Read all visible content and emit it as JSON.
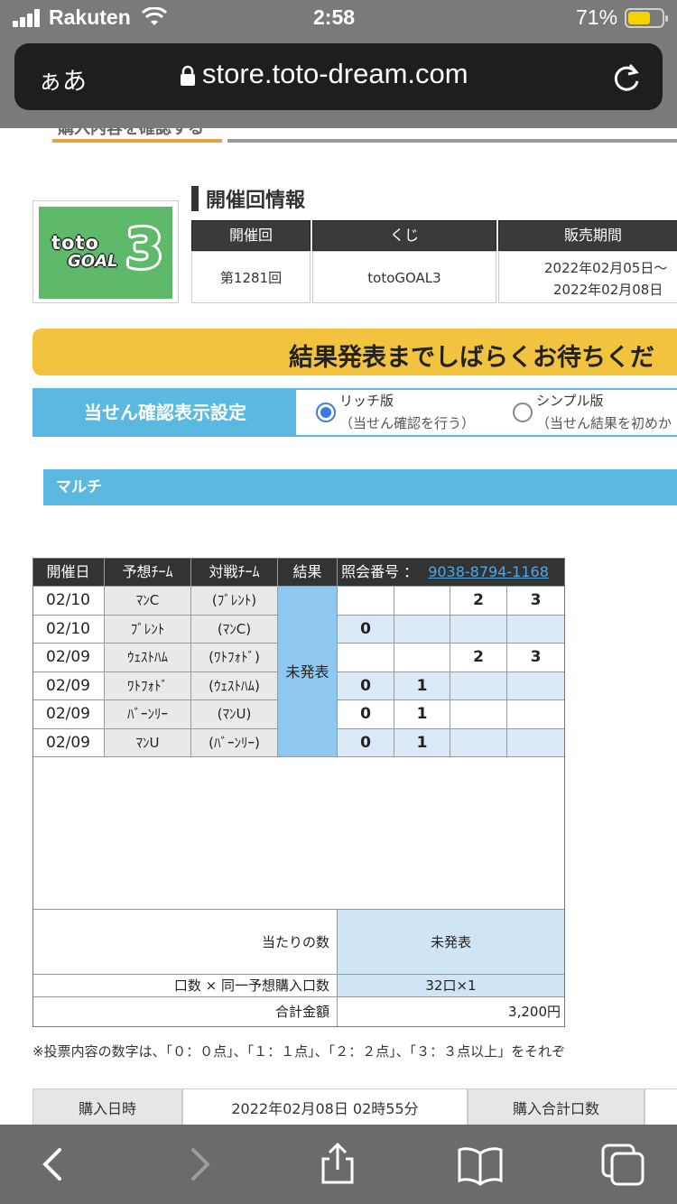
{
  "status_bar": {
    "carrier": "Rakuten",
    "time": "2:58",
    "battery": "71%"
  },
  "address_bar": {
    "text_size_label": "ぁあ",
    "url": "store.toto-dream.com"
  },
  "page_top": {
    "partial_text": "購入内容を確認する"
  },
  "logo": {
    "line1": "toto",
    "line2": "GOAL",
    "number": "3"
  },
  "event_info": {
    "title": "開催回情報",
    "headers": [
      "開催回",
      "くじ",
      "販売期間"
    ],
    "round": "第1281回",
    "lottery": "totoGOAL3",
    "period_line1": "2022年02月05日〜",
    "period_line2": "2022年02月08日"
  },
  "banner": {
    "text": "結果発表までしばらくお待ちくだ"
  },
  "display_setting": {
    "label": "当せん確認表示設定",
    "rich_label": "リッチ版",
    "rich_sub": "（当せん確認を行う）",
    "simple_label": "シンプル版",
    "simple_sub": "（当せん結果を初めか"
  },
  "multi": {
    "label": "マルチ"
  },
  "table": {
    "headers": {
      "date": "開催日",
      "pred": "予想ﾁｰﾑ",
      "opp": "対戦ﾁｰﾑ",
      "result": "結果",
      "ref_label": "照会番号 ：",
      "ref_no": "9038-8794-1168"
    },
    "result_value": "未発表",
    "rows": [
      {
        "date": "02/10",
        "team": "ﾏﾝC",
        "opp": "(ﾌﾞﾚﾝﾄ)",
        "c1": "",
        "c2": "",
        "c3": "2",
        "c4": "3"
      },
      {
        "date": "02/10",
        "team": "ﾌﾞﾚﾝﾄ",
        "opp": "(ﾏﾝC)",
        "c1": "0",
        "c2": "",
        "c3": "",
        "c4": ""
      },
      {
        "date": "02/09",
        "team": "ｳｪｽﾄﾊﾑ",
        "opp": "(ﾜﾄﾌｫﾄﾞ)",
        "c1": "",
        "c2": "",
        "c3": "2",
        "c4": "3"
      },
      {
        "date": "02/09",
        "team": "ﾜﾄﾌｫﾄﾞ",
        "opp": "(ｳｪｽﾄﾊﾑ)",
        "c1": "0",
        "c2": "1",
        "c3": "",
        "c4": ""
      },
      {
        "date": "02/09",
        "team": "ﾊﾞｰﾝﾘｰ",
        "opp": "(ﾏﾝU)",
        "c1": "0",
        "c2": "1",
        "c3": "",
        "c4": ""
      },
      {
        "date": "02/09",
        "team": "ﾏﾝU",
        "opp": "(ﾊﾞｰﾝﾘｰ)",
        "c1": "0",
        "c2": "1",
        "c3": "",
        "c4": ""
      }
    ],
    "hits_label": "当たりの数",
    "hits_value": "未発表",
    "units_label": "口数 × 同一予想購入口数",
    "units_value": "32口×1",
    "total_label": "合計金額",
    "total_value": "3,200円"
  },
  "note": "※投票内容の数字は、「０：０点」、「１：１点」、「２：２点」、「３：３点以上」をそれぞ",
  "purchase": {
    "date_label": "購入日時",
    "date_value": "2022年02月08日 02時55分",
    "units_label": "購入合計口数"
  },
  "colors": {
    "accent_blue": "#5bb8e0",
    "banner_yellow": "#f2c33e",
    "link_blue": "#2a6fb5"
  }
}
